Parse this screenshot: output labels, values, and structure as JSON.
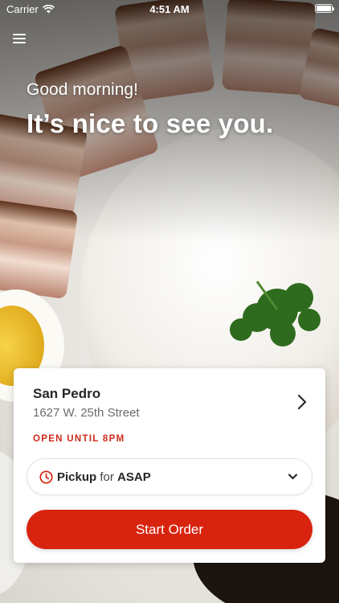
{
  "status_bar": {
    "carrier": "Carrier",
    "time": "4:51 AM",
    "wifi_icon": "wifi-icon",
    "battery_icon": "battery-icon"
  },
  "header": {
    "menu_icon": "hamburger-menu-icon",
    "greeting": "Good morning!",
    "headline": "It’s nice to see you."
  },
  "location": {
    "name": "San Pedro",
    "address": "1627 W. 25th Street",
    "hours_status": "OPEN UNTIL 8PM",
    "chevron_icon": "chevron-right-icon"
  },
  "order_mode": {
    "mode": "Pickup",
    "connector": "for",
    "time": "ASAP",
    "clock_icon": "clock-icon",
    "dropdown_icon": "chevron-down-icon"
  },
  "actions": {
    "start_order_label": "Start Order"
  },
  "colors": {
    "brand_red": "#d8230f",
    "status_red": "#cf2a1c",
    "text_dark": "#262626",
    "text_muted": "#6b6b6b"
  }
}
